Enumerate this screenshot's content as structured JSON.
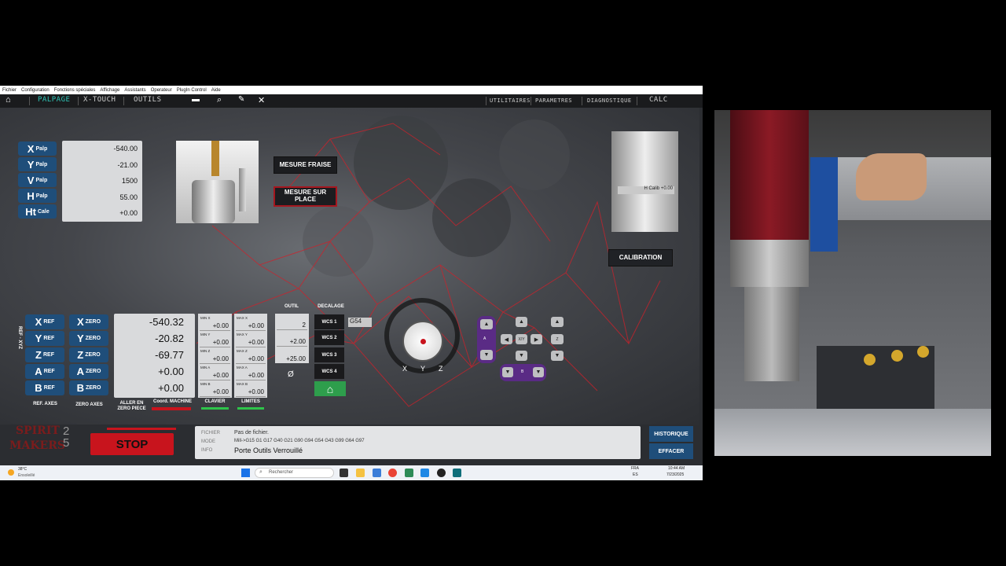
{
  "menu": [
    "Fichier",
    "Configuration",
    "Fonctions spéciales",
    "Affichage",
    "Assistants",
    "Operateur",
    "PlugIn Control",
    "Aide"
  ],
  "toolbar": {
    "tabs": [
      "PALPAGE",
      "X-TOUCH",
      "OUTILS"
    ],
    "right_tabs": [
      "UTILITAIRES",
      "PARAMETRES",
      "DIAGNOSTIQUE",
      "CALC"
    ]
  },
  "probe": {
    "labels": [
      {
        "big": "X",
        "small": "Palp"
      },
      {
        "big": "Y",
        "small": "Palp"
      },
      {
        "big": "V",
        "small": "Palp"
      },
      {
        "big": "H",
        "small": "Palp"
      },
      {
        "big": "Ht",
        "small": "Cale"
      }
    ],
    "values": [
      "-540.00",
      "-21.00",
      "1500",
      "55.00",
      "+0.00"
    ]
  },
  "buttons": {
    "mesure_fraise": "MESURE FRAISE",
    "mesure_sur_place": "MESURE SUR PLACE",
    "calibration": "CALIBRATION",
    "h_calib": "H Calib +0.00"
  },
  "axes": {
    "side_label": "REF - XYZ",
    "ref": [
      {
        "big": "X",
        "small": "REF"
      },
      {
        "big": "Y",
        "small": "REF"
      },
      {
        "big": "Z",
        "small": "REF"
      },
      {
        "big": "A",
        "small": "REF"
      },
      {
        "big": "B",
        "small": "REF"
      }
    ],
    "zero": [
      {
        "big": "X",
        "small": "ZERO"
      },
      {
        "big": "Y",
        "small": "ZERO"
      },
      {
        "big": "Z",
        "small": "ZERO"
      },
      {
        "big": "A",
        "small": "ZERO"
      },
      {
        "big": "B",
        "small": "ZERO"
      }
    ],
    "dro": [
      "-540.32",
      "-20.82",
      "-69.77",
      "+0.00",
      "+0.00"
    ],
    "ref_axes": "REF. AXES",
    "zero_axes": "ZERO AXES",
    "aller_zero": "ALLER EN ZERO PIECE",
    "coord_machine": "Coord. MACHINE",
    "clavier": "CLAVIER",
    "limites": "LIMITES"
  },
  "mins": {
    "labels": [
      "MIN X",
      "MIN Y",
      "MIN Z",
      "MIN A",
      "MIN B"
    ],
    "values": [
      "+0.00",
      "+0.00",
      "+0.00",
      "+0.00",
      "+0.00"
    ]
  },
  "maxs": {
    "labels": [
      "MAX X",
      "MAX Y",
      "MAX Z",
      "MAX A",
      "MAX B"
    ],
    "values": [
      "+0.00",
      "+0.00",
      "+0.00",
      "+0.00",
      "+0.00"
    ]
  },
  "outil": {
    "title": "OUTIL",
    "values": [
      "2",
      "+2.00",
      "+25.00"
    ],
    "diam": "Ø"
  },
  "decalage": {
    "title": "DECALAGE",
    "wcs": [
      "WCS 1",
      "WCS 2",
      "WCS 3",
      "WCS 4"
    ],
    "current": "G54"
  },
  "dial": {
    "labels": [
      "X",
      "Y",
      "Z"
    ]
  },
  "jog": {
    "xy": "X/Y",
    "z": "Z",
    "a": "A",
    "b": "B"
  },
  "status": {
    "logo_top": "SPIRIT",
    "logo_bottom": "MAKERS",
    "logo_num": "25",
    "stop": "STOP",
    "fichier_lbl": "FICHIER",
    "fichier": "Pas de fichier.",
    "mode_lbl": "MODE",
    "mode": "Mill->G15  G1 G17 G40 G21 G90 G94 G54 G43 G99 G64 G97",
    "info_lbl": "INFO",
    "info": "Porte Outils Verrouillé",
    "historique": "HISTORIQUE",
    "effacer": "EFFACER"
  },
  "taskbar": {
    "temp": "38°C",
    "weather": "Ensoleillé",
    "search": "Rechercher",
    "lang1": "FRA",
    "lang2": "ES",
    "time": "10:44 AM",
    "date": "7/23/2025"
  }
}
